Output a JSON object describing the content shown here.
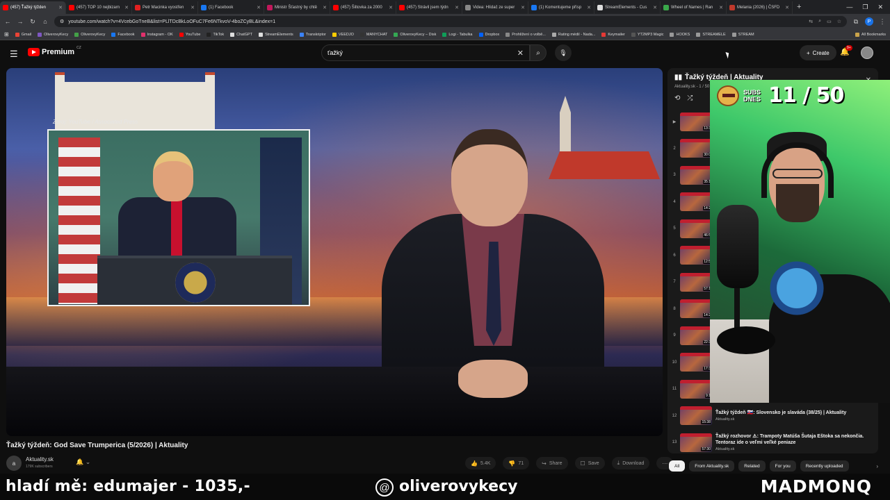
{
  "browser": {
    "tabs": [
      {
        "label": "(457) Ťažký týžden",
        "color": "#ff0000",
        "active": true
      },
      {
        "label": "(457) TOP 10 nejbizarn",
        "color": "#ff0000"
      },
      {
        "label": "Petr Macinka vyostřen",
        "color": "#e02020"
      },
      {
        "label": "(1) Facebook",
        "color": "#1877f2"
      },
      {
        "label": "Ministr Šťastný by chtě",
        "color": "#c2185b"
      },
      {
        "label": "(457) Šiltovka za 2000",
        "color": "#ff0000"
      },
      {
        "label": "(457) Strávil jsem týdn",
        "color": "#ff0000"
      },
      {
        "label": "Videa: Hlídač ze super",
        "color": "#888888"
      },
      {
        "label": "(1) Komentujeme přísp",
        "color": "#1877f2"
      },
      {
        "label": "StreamElements - Cus",
        "color": "#dddddd"
      },
      {
        "label": "Wheel of Names | Ran",
        "color": "#3aa84a"
      },
      {
        "label": "Melania (2026) | ČSFD",
        "color": "#c0392b"
      }
    ],
    "new_tab": "+",
    "url": "youtube.com/watch?v=4VcebGoTneB&list=PLlTDcBkLoOFuC7Fe6NTkvoV-4boZCyBL&index=1",
    "profile_initial": "P",
    "bookmarks": [
      {
        "label": "Gmail",
        "color": "#ea4335"
      },
      {
        "label": "OliverovyKecy",
        "color": "#7e57c2"
      },
      {
        "label": "OliverovyKecy",
        "color": "#43a047"
      },
      {
        "label": "Facebook",
        "color": "#1877f2"
      },
      {
        "label": "Instagram - OK",
        "color": "#e1306c"
      },
      {
        "label": "YouTube",
        "color": "#ff0000"
      },
      {
        "label": "TikTok",
        "color": "#222222"
      },
      {
        "label": "ChatGPT",
        "color": "#dddddd"
      },
      {
        "label": "StreamElements",
        "color": "#dddddd"
      },
      {
        "label": "Transkriptor",
        "color": "#3b82f6"
      },
      {
        "label": "VEEDJO",
        "color": "#ffcc00"
      },
      {
        "label": "MANYCHAT",
        "color": "#333333"
      },
      {
        "label": "OliverovyKecy – Disk",
        "color": "#34a853"
      },
      {
        "label": "Logi - Tabulka",
        "color": "#0f9d58"
      },
      {
        "label": "Dropbox",
        "color": "#0061ff"
      },
      {
        "label": "Prohlížení o volbě...",
        "color": "#888888"
      },
      {
        "label": "Rating médií - Nada...",
        "color": "#aaaaaa"
      },
      {
        "label": "Keymailer",
        "color": "#e53935"
      },
      {
        "label": "YT2MP3 Magic",
        "color": "#555555"
      },
      {
        "label": "HOOKS",
        "color": "#999999"
      },
      {
        "label": "STREAMELE",
        "color": "#999999"
      },
      {
        "label": "STREAM",
        "color": "#999999"
      }
    ],
    "all_bookmarks": "All Bookmarks"
  },
  "youtube": {
    "logo_text": "Premium",
    "logo_region": "CZ",
    "search_value": "ťažký",
    "create_label": "Create",
    "notif_badge": "9+"
  },
  "video": {
    "source_caption": "Zdroj: YouTube / Associated Press",
    "title": "Ťažký týždeň: God Save Trumperica (5/2026) | Aktuality",
    "channel_name": "Aktuality.sk",
    "channel_avatar": "a",
    "channel_subs": "179K subscribers",
    "likes": "5.4K",
    "dislikes": "71",
    "share_label": "Share",
    "save_label": "Save",
    "download_label": "Download"
  },
  "playlist": {
    "title": "Ťažký týždeň | Aktuality",
    "subtitle": "Aktuality.sk - 1 / 50",
    "items": [
      {
        "index": "",
        "dur": "13:3",
        "title": "",
        "channel": ""
      },
      {
        "index": "2",
        "dur": "30:0",
        "title": "",
        "channel": ""
      },
      {
        "index": "3",
        "dur": "35:1",
        "title": "",
        "channel": ""
      },
      {
        "index": "4",
        "dur": "14:2",
        "title": "",
        "channel": ""
      },
      {
        "index": "5",
        "dur": "46:5",
        "title": "",
        "channel": ""
      },
      {
        "index": "6",
        "dur": "12:5",
        "title": "",
        "channel": ""
      },
      {
        "index": "7",
        "dur": "57:1",
        "title": "",
        "channel": ""
      },
      {
        "index": "8",
        "dur": "14:2",
        "title": "",
        "channel": ""
      },
      {
        "index": "9",
        "dur": "22:3",
        "title": "",
        "channel": ""
      },
      {
        "index": "10",
        "dur": "17:3",
        "title": "",
        "channel": ""
      },
      {
        "index": "11",
        "dur": "9:1",
        "title": "",
        "channel": ""
      },
      {
        "index": "12",
        "dur": "15:38",
        "title": "Ťažký týždeň 🇸🇰: Slovensko je slaváda (38/25) | Aktuality",
        "channel": "Aktuality.sk"
      },
      {
        "index": "13",
        "dur": "57:30",
        "title": "Ťažký rozhovor ⚠: Trampoty Matúša Šutaja Eštoka sa nekončia. Tentoraz ide o veľmi veľké peniaze",
        "channel": "Aktuality.sk"
      }
    ]
  },
  "chips": [
    {
      "label": "All",
      "active": true
    },
    {
      "label": "From Aktuality.sk",
      "active": false
    },
    {
      "label": "Related",
      "active": false
    },
    {
      "label": "For you",
      "active": false
    },
    {
      "label": "Recently uploaded",
      "active": false
    }
  ],
  "stream_overlay": {
    "subs_label": "SUBS DNES",
    "subs_count": "11 / 50",
    "left_text": "hladí mě: edumajer - 1035,-",
    "threads_handle": "oliverovykecy",
    "right_text": "MADMONQ"
  },
  "colors": {
    "youtube_red": "#ff0000",
    "background": "#0f0f0f",
    "webcam_green": "#3ec86a"
  }
}
